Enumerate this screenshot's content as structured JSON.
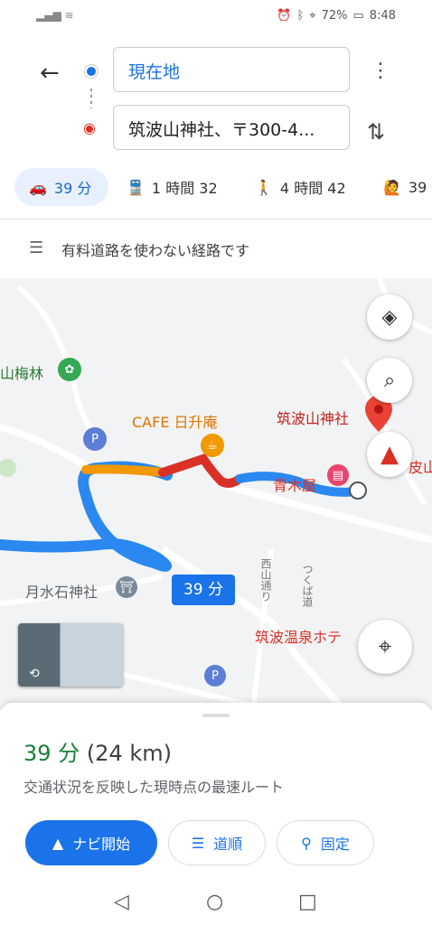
{
  "status": {
    "battery": "72%",
    "time": "8:48"
  },
  "directions": {
    "origin": "現在地",
    "destination": "筑波山神社、〒300-4..."
  },
  "modes": [
    {
      "icon": "car-icon",
      "label": "39 分"
    },
    {
      "icon": "train-icon",
      "label": "1 時間 32"
    },
    {
      "icon": "walk-icon",
      "label": "4 時間 42"
    },
    {
      "icon": "rideshare-icon",
      "label": "39"
    }
  ],
  "avoid_notice": "有料道路を使わない経路です",
  "map": {
    "labels": {
      "plum_grove": "山梅林",
      "cafe": "CAFE 日升庵",
      "shrine": "筑波山神社",
      "aokiya": "青木屋",
      "getsusui": "月水石神社",
      "onsen": "筑波温泉ホテ",
      "nishiyama": "西山通り",
      "tsukuba_road": "つくば道",
      "edge": "皮山"
    },
    "route_badge": "39 分"
  },
  "sheet": {
    "duration": "39 分",
    "distance": "(24 km)",
    "description": "交通状況を反映した現時点の最速ルート",
    "start_label": "ナビ開始",
    "steps_label": "道順",
    "pin_label": "固定"
  }
}
